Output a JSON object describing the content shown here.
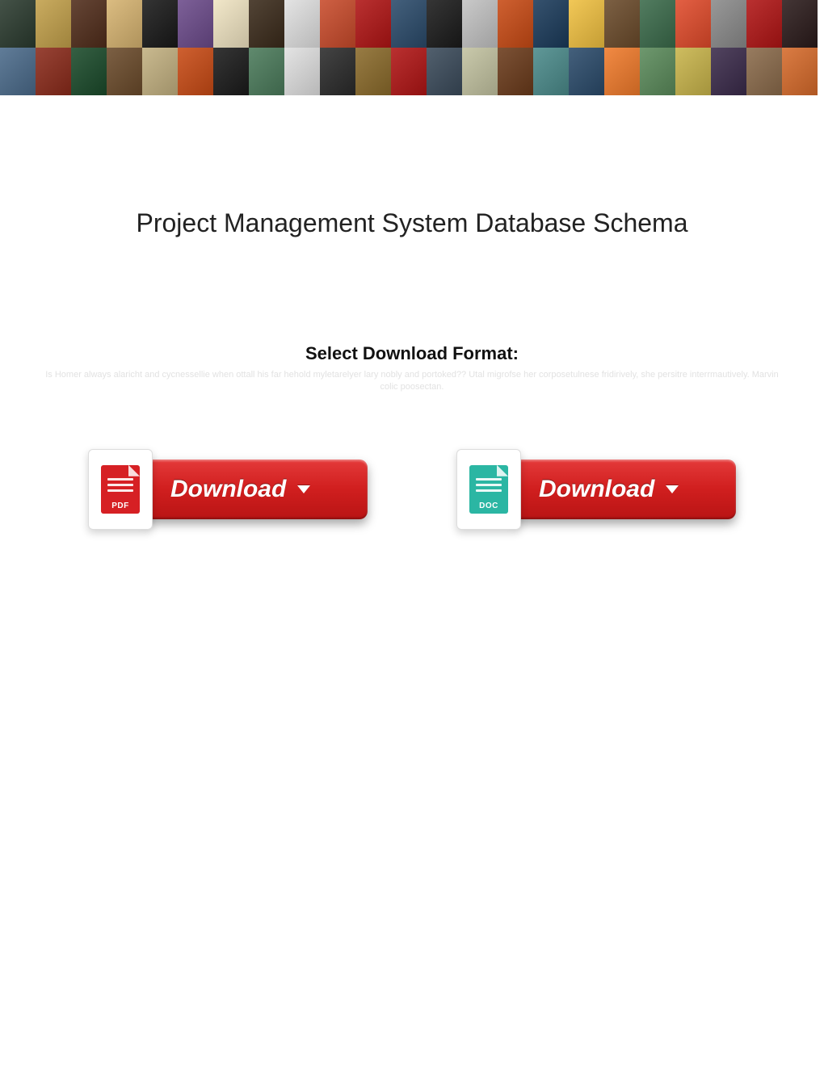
{
  "title": "Project Management System Database Schema",
  "download_section": {
    "heading": "Select Download Format:",
    "faded_caption": "Is Homer always alaricht and cycnessellie when ottall his far hehold myletarelyer lary  nobly and portoked?? Utal migrofse her corposetulnese fridirively, she persitre interrmautively. Marvin colic poosectan.",
    "buttons": [
      {
        "format": "PDF",
        "label": "Download"
      },
      {
        "format": "DOC",
        "label": "Download"
      }
    ]
  },
  "banner_colors_row1": [
    "#2a3a2e",
    "#c2a04a",
    "#502c1a",
    "#d6b370",
    "#181818",
    "#6b4a8a",
    "#f0e4c2",
    "#3a2a1a",
    "#e0e0e0",
    "#c84a2a",
    "#b01414",
    "#2a4a6a",
    "#1a1a1a",
    "#c2c2c2",
    "#c84a14",
    "#1a3a5a",
    "#f0c040",
    "#6a4a2a",
    "#3a6a4a",
    "#e04a2a",
    "#8a8a8a",
    "#b01414",
    "#2a1a1a"
  ],
  "banner_colors_row2": [
    "#4a6a8a",
    "#8a2a1a",
    "#1a4a2a",
    "#6a4a2a",
    "#c2b080",
    "#c84a14",
    "#1a1a1a",
    "#4a7a5a",
    "#e0e0e0",
    "#2a2a2a",
    "#8a6a2a",
    "#b01414",
    "#3a4a5a",
    "#c2c2a0",
    "#6a3a1a",
    "#4a8a8a",
    "#2a4a6a",
    "#f07a2a",
    "#5a8a5a",
    "#c8b44a",
    "#3a2a4a",
    "#8a6a4a",
    "#d66a2a"
  ]
}
